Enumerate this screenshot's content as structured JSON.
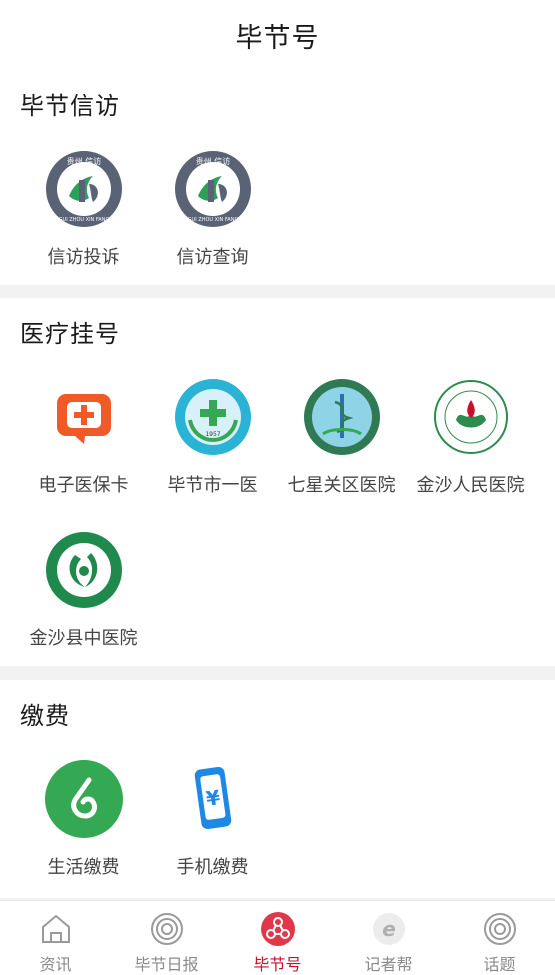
{
  "header": {
    "title": "毕节号"
  },
  "sections": [
    {
      "title": "毕节信访",
      "items": [
        {
          "label": "信访投诉",
          "icon": "guizhou-xinfang-logo-icon"
        },
        {
          "label": "信访查询",
          "icon": "guizhou-xinfang-logo-icon"
        }
      ]
    },
    {
      "title": "医疗挂号",
      "items": [
        {
          "label": "电子医保卡",
          "icon": "medical-card-icon"
        },
        {
          "label": "毕节市一医",
          "icon": "hospital-logo-icon"
        },
        {
          "label": "七星关区医院",
          "icon": "hospital-logo-icon"
        },
        {
          "label": "金沙人民医院",
          "icon": "hospital-logo-icon"
        },
        {
          "label": "金沙县中医院",
          "icon": "hospital-logo-icon"
        }
      ]
    },
    {
      "title": "缴费",
      "items": [
        {
          "label": "生活缴费",
          "icon": "life-payment-icon"
        },
        {
          "label": "手机缴费",
          "icon": "phone-payment-icon"
        }
      ]
    }
  ],
  "logo_text": {
    "guizhou_top": "贵州 信访",
    "guizhou_bottom": "GUI ZHOU XIN FANG",
    "bijie_year": "1957",
    "yen": "¥"
  },
  "tabbar": [
    {
      "label": "资讯",
      "icon": "home-icon",
      "active": false
    },
    {
      "label": "毕节日报",
      "icon": "target-icon",
      "active": false
    },
    {
      "label": "毕节号",
      "icon": "network-icon",
      "active": true
    },
    {
      "label": "记者帮",
      "icon": "e-icon",
      "active": false
    },
    {
      "label": "话题",
      "icon": "target-icon",
      "active": false
    }
  ],
  "colors": {
    "accent": "#c8102e",
    "green": "#34a853",
    "xinfang_gray": "#5a6275",
    "medical_orange": "#f05a28",
    "phone_blue": "#1e88e5"
  }
}
